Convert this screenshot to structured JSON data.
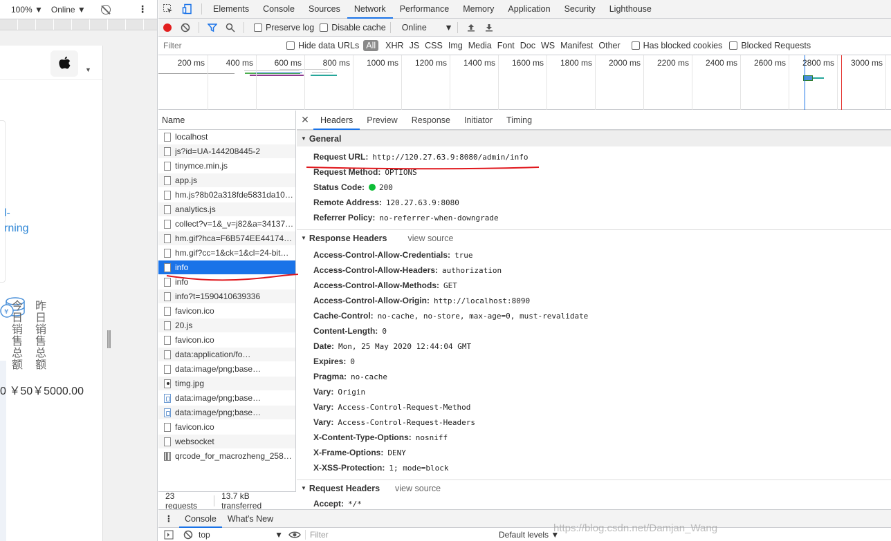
{
  "viewport": {
    "zoom": "100% ▼",
    "network": "Online ▼",
    "link_text": "l-\nrning",
    "vertical_text_1": "今日销售总额",
    "vertical_text_2": "昨日销售总额",
    "money_text": "0 ￥50￥5000.00"
  },
  "devtools": {
    "tabs": [
      {
        "label": "Elements"
      },
      {
        "label": "Console"
      },
      {
        "label": "Sources"
      },
      {
        "label": "Network",
        "active": true
      },
      {
        "label": "Performance"
      },
      {
        "label": "Memory"
      },
      {
        "label": "Application"
      },
      {
        "label": "Security"
      },
      {
        "label": "Lighthouse"
      }
    ],
    "toolbar": {
      "preserve_log": "Preserve log",
      "disable_cache": "Disable cache",
      "throttle": "Online"
    },
    "filter": {
      "placeholder": "Filter",
      "hide_data_urls": "Hide data URLs",
      "types": [
        "All",
        "XHR",
        "JS",
        "CSS",
        "Img",
        "Media",
        "Font",
        "Doc",
        "WS",
        "Manifest",
        "Other"
      ],
      "has_blocked_cookies": "Has blocked cookies",
      "blocked_requests": "Blocked Requests"
    },
    "timeline_labels": [
      "200 ms",
      "400 ms",
      "600 ms",
      "800 ms",
      "1000 ms",
      "1200 ms",
      "1400 ms",
      "1600 ms",
      "1800 ms",
      "2000 ms",
      "2200 ms",
      "2400 ms",
      "2600 ms",
      "2800 ms",
      "3000 ms"
    ],
    "request_list": {
      "header": "Name",
      "rows": [
        {
          "name": "localhost",
          "icon": "doc"
        },
        {
          "name": "js?id=UA-144208445-2",
          "icon": "doc"
        },
        {
          "name": "tinymce.min.js",
          "icon": "doc"
        },
        {
          "name": "app.js",
          "icon": "doc"
        },
        {
          "name": "hm.js?8b02a318fde5831da104…",
          "icon": "doc"
        },
        {
          "name": "analytics.js",
          "icon": "doc"
        },
        {
          "name": "collect?v=1&_v=j82&a=34137…",
          "icon": "doc"
        },
        {
          "name": "hm.gif?hca=F6B574EE441745…",
          "icon": "doc"
        },
        {
          "name": "hm.gif?cc=1&ck=1&cl=24-bit…",
          "icon": "doc"
        },
        {
          "name": "info",
          "icon": "doc",
          "selected": true
        },
        {
          "name": "info",
          "icon": "doc"
        },
        {
          "name": "info?t=1590410639336",
          "icon": "doc"
        },
        {
          "name": "favicon.ico",
          "icon": "doc"
        },
        {
          "name": "20.js",
          "icon": "doc"
        },
        {
          "name": "favicon.ico",
          "icon": "doc"
        },
        {
          "name": "data:application/fo…",
          "icon": "doc"
        },
        {
          "name": "data:image/png;base…",
          "icon": "doc"
        },
        {
          "name": "timg.jpg",
          "icon": "dot"
        },
        {
          "name": "data:image/png;base…",
          "icon": "img"
        },
        {
          "name": "data:image/png;base…",
          "icon": "img"
        },
        {
          "name": "favicon.ico",
          "icon": "doc"
        },
        {
          "name": "websocket",
          "icon": "doc"
        },
        {
          "name": "qrcode_for_macrozheng_258.j…",
          "icon": "grid"
        }
      ],
      "summary_requests": "23 requests",
      "summary_transferred": "13.7 kB transferred"
    },
    "details": {
      "tabs": [
        {
          "label": "Headers",
          "active": true
        },
        {
          "label": "Preview"
        },
        {
          "label": "Response"
        },
        {
          "label": "Initiator"
        },
        {
          "label": "Timing"
        }
      ],
      "general_title": "General",
      "general": [
        {
          "k": "Request URL:",
          "v": "http://120.27.63.9:8080/admin/info"
        },
        {
          "k": "Request Method:",
          "v": "OPTIONS"
        },
        {
          "k": "Status Code:",
          "v": "200",
          "dot": true
        },
        {
          "k": "Remote Address:",
          "v": "120.27.63.9:8080"
        },
        {
          "k": "Referrer Policy:",
          "v": "no-referrer-when-downgrade"
        }
      ],
      "response_title": "Response Headers",
      "view_source": "view source",
      "response": [
        {
          "k": "Access-Control-Allow-Credentials:",
          "v": "true"
        },
        {
          "k": "Access-Control-Allow-Headers:",
          "v": "authorization"
        },
        {
          "k": "Access-Control-Allow-Methods:",
          "v": "GET"
        },
        {
          "k": "Access-Control-Allow-Origin:",
          "v": "http://localhost:8090"
        },
        {
          "k": "Cache-Control:",
          "v": "no-cache, no-store, max-age=0, must-revalidate"
        },
        {
          "k": "Content-Length:",
          "v": "0"
        },
        {
          "k": "Date:",
          "v": "Mon, 25 May 2020 12:44:04 GMT"
        },
        {
          "k": "Expires:",
          "v": "0"
        },
        {
          "k": "Pragma:",
          "v": "no-cache"
        },
        {
          "k": "Vary:",
          "v": "Origin"
        },
        {
          "k": "Vary:",
          "v": "Access-Control-Request-Method"
        },
        {
          "k": "Vary:",
          "v": "Access-Control-Request-Headers"
        },
        {
          "k": "X-Content-Type-Options:",
          "v": "nosniff"
        },
        {
          "k": "X-Frame-Options:",
          "v": "DENY"
        },
        {
          "k": "X-XSS-Protection:",
          "v": "1; mode=block"
        }
      ],
      "request_title": "Request Headers",
      "request": [
        {
          "k": "Accept:",
          "v": "*/*"
        }
      ]
    },
    "drawer": {
      "tabs": [
        {
          "label": "Console",
          "active": true
        },
        {
          "label": "What's New"
        }
      ],
      "context": "top",
      "filter_placeholder": "Filter",
      "levels": "Default levels ▼"
    }
  },
  "watermark": "https://blog.csdn.net/Damjan_Wang",
  "colors": {
    "accent": "#1a73e8",
    "record": "#e21e1e",
    "annotation": "#e0161b",
    "status_ok": "#0dbd36"
  }
}
